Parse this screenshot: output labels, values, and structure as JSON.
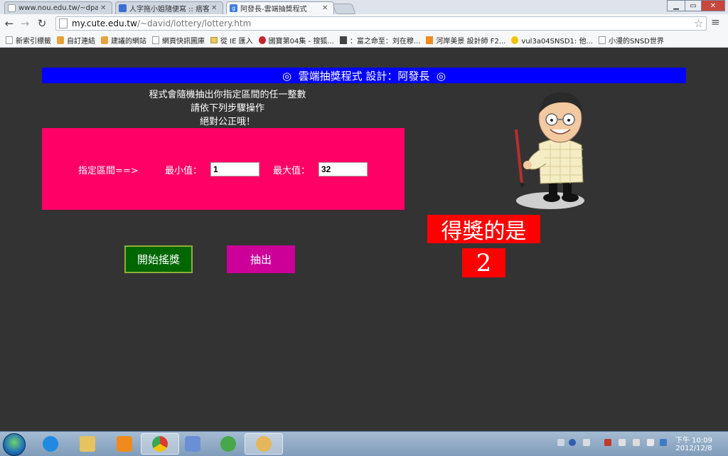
{
  "browser": {
    "tabs": [
      {
        "label": "www.nou.edu.tw/~dpa/",
        "favicon": "page-icon",
        "active": false
      },
      {
        "label": "人字拖小姐隨便寫 :: 痞客",
        "favicon": "blog-icon",
        "active": false
      },
      {
        "label": "阿發長-雲端抽獎程式",
        "favicon": "google-icon",
        "active": true
      }
    ],
    "url_host": "my.cute.edu.tw",
    "url_path": "/~david/lottery/lottery.htm",
    "bookmarks": [
      {
        "label": "新索引標籤",
        "icon": "page"
      },
      {
        "label": "自訂連結",
        "icon": "fav"
      },
      {
        "label": "建議的網站",
        "icon": "fav"
      },
      {
        "label": "網頁快訊圖庫",
        "icon": "page"
      },
      {
        "label": "從 IE 匯入",
        "icon": "folder"
      },
      {
        "label": "國寶第04集 - 搜狐...",
        "icon": "red"
      },
      {
        "label": "：富之命至：刘在穆...",
        "icon": "grey"
      },
      {
        "label": "河岸美景 設計師 F2...",
        "icon": "orange"
      },
      {
        "label": "vul3a04SNSD1: 他...",
        "icon": "yellow"
      },
      {
        "label": "小漫的SNSD世界",
        "icon": "page"
      }
    ]
  },
  "app": {
    "banner": "◎  雲端抽獎程式 設計：阿發長  ◎",
    "intro_lines": [
      "程式會隨機抽出你指定區間的任一整數",
      "請依下列步驟操作",
      "絕對公正哦！"
    ],
    "range_label": "指定區間==>",
    "min_label": "最小值：",
    "min_value": "1",
    "max_label": "最大值：",
    "max_value": "32",
    "start_button": "開始搖獎",
    "draw_button": "抽出",
    "winner_title": "得獎的是",
    "winner_number": "2"
  },
  "taskbar": {
    "clock_time": "下午 10:09",
    "clock_date": "2012/12/8"
  },
  "colors": {
    "banner": "#0000ff",
    "form_box": "#ff0066",
    "start_button": "#006600",
    "draw_button": "#cc0099",
    "winner": "#ff0000",
    "page_bg": "#333333"
  }
}
